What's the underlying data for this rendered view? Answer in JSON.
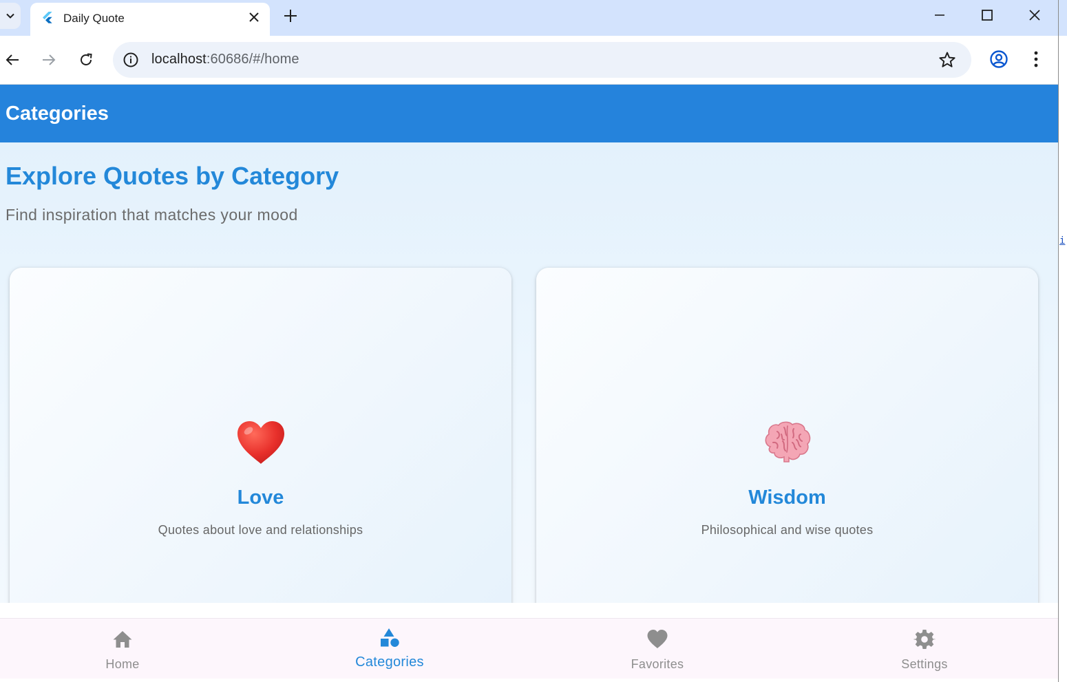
{
  "browser": {
    "tab": {
      "title": "Daily Quote"
    },
    "address": {
      "host": "localhost",
      "rest": ":60686/#/home"
    },
    "side_fragment": "i"
  },
  "app": {
    "appbar_title": "Categories",
    "heading": "Explore Quotes by Category",
    "subheading": "Find inspiration that matches your mood",
    "categories": [
      {
        "emoji": "❤️",
        "icon": "red-heart-emoji",
        "title": "Love",
        "description": "Quotes about love and relationships"
      },
      {
        "emoji": "🧠",
        "icon": "brain-emoji",
        "title": "Wisdom",
        "description": "Philosophical and wise quotes"
      }
    ],
    "bottom_nav": [
      {
        "label": "Home",
        "icon": "home-icon",
        "active": false
      },
      {
        "label": "Categories",
        "icon": "category-icon",
        "active": true
      },
      {
        "label": "Favorites",
        "icon": "heart-icon",
        "active": false
      },
      {
        "label": "Settings",
        "icon": "gear-icon",
        "active": false
      }
    ]
  },
  "colors": {
    "primary": "#2583dc",
    "accent_text": "#2388d9",
    "inactive_nav": "#8e8e8e",
    "chrome_tabbar": "#d3e3fd"
  }
}
